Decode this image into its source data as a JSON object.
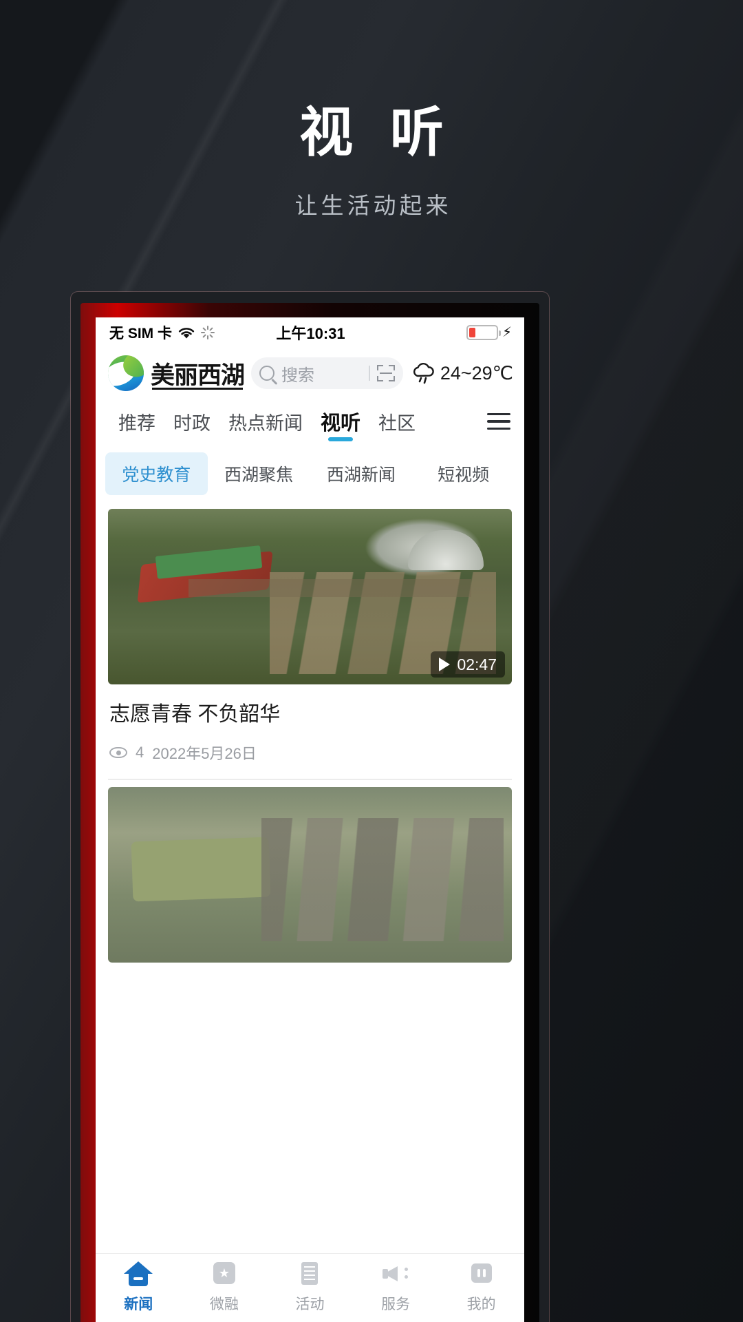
{
  "promo": {
    "title": "视 听",
    "subtitle": "让生活动起来"
  },
  "phone": {
    "status_bar": {
      "carrier": "无 SIM 卡",
      "wifi_icon": "wifi-icon",
      "sync_icon": "spinner-icon",
      "time": "上午10:31",
      "battery_icon": "battery-low-icon",
      "charging_icon": "lightning-bolt-icon"
    },
    "header": {
      "logo_icon": "app-logo-swirl-icon",
      "brand": "美丽西湖",
      "search": {
        "icon": "search-icon",
        "placeholder": "搜索",
        "scan_icon": "scan-code-icon"
      },
      "weather": {
        "icon": "rain-cloud-icon",
        "text": "24~29℃"
      },
      "menu_icon": "hamburger-menu-icon"
    },
    "nav_tabs": [
      {
        "label": "推荐",
        "active": false
      },
      {
        "label": "时政",
        "active": false
      },
      {
        "label": "热点新闻",
        "active": false
      },
      {
        "label": "视听",
        "active": true
      },
      {
        "label": "社区",
        "active": false
      }
    ],
    "sub_tabs": [
      {
        "label": "党史教育",
        "active": true
      },
      {
        "label": "西湖聚焦",
        "active": false
      },
      {
        "label": "西湖新闻",
        "active": false
      },
      {
        "label": "短视频",
        "active": false
      }
    ],
    "videos": [
      {
        "title": "志愿青春 不负韶华",
        "duration": "02:47",
        "play_icon": "play-icon",
        "views_icon": "eye-icon",
        "views": "4",
        "date": "2022年5月26日"
      },
      {
        "title": "",
        "duration": "",
        "play_icon": "play-icon",
        "views_icon": "eye-icon",
        "views": "",
        "date": ""
      }
    ],
    "bottom_nav": [
      {
        "label": "新闻",
        "icon": "home-icon",
        "active": true
      },
      {
        "label": "微融",
        "icon": "star-square-icon",
        "active": false
      },
      {
        "label": "活动",
        "icon": "document-lines-icon",
        "active": false
      },
      {
        "label": "服务",
        "icon": "megaphone-icon",
        "active": false
      },
      {
        "label": "我的",
        "icon": "user-icon",
        "active": false
      }
    ]
  },
  "colors": {
    "accent_blue": "#29a8db",
    "active_nav": "#1b70c0",
    "subtab_active_bg": "#e3f2fb",
    "frame_red": "#c00000"
  }
}
